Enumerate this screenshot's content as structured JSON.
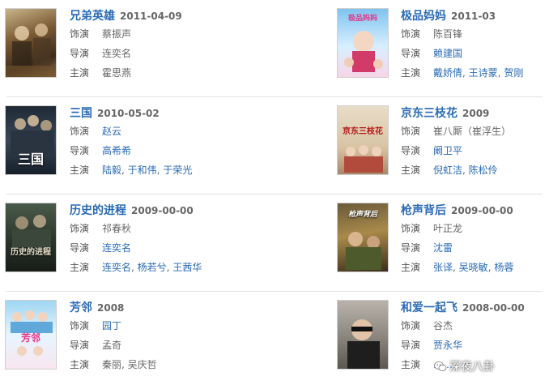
{
  "labels": {
    "role": "饰演",
    "director": "导演",
    "cast": "主演"
  },
  "cards": [
    {
      "title": "兄弟英雄",
      "date": "2011-04-09",
      "role": "蔡振声",
      "director": "连奕名",
      "cast": [
        "霍思燕"
      ],
      "poster_text": ""
    },
    {
      "title": "极品妈妈",
      "date": "2011-03",
      "role": "陈百锋",
      "director": "赖建国",
      "cast": [
        "戴娇倩",
        "王诗蒙",
        "贺刚"
      ],
      "poster_text": "极品妈妈"
    },
    {
      "title": "三国",
      "date": "2010-05-02",
      "role": "赵云",
      "director": "高希希",
      "cast": [
        "陆毅",
        "于和伟",
        "于荣光"
      ],
      "poster_text": "三国"
    },
    {
      "title": "京东三枝花",
      "date": "2009",
      "role": "崔八厮（崔浮生）",
      "director": "阚卫平",
      "cast": [
        "倪虹洁",
        "陈松伶"
      ],
      "poster_text": "京东三枝花"
    },
    {
      "title": "历史的进程",
      "date": "2009-00-00",
      "role": "祁春秋",
      "director": "连奕名",
      "cast": [
        "连奕名",
        "杨若兮",
        "王茜华"
      ],
      "poster_text": "历史的进程"
    },
    {
      "title": "枪声背后",
      "date": "2009-00-00",
      "role": "叶正龙",
      "director": "沈雷",
      "cast": [
        "张译",
        "吴晓敏",
        "杨蓉"
      ],
      "poster_text": "枪声背后"
    },
    {
      "title": "芳邻",
      "date": "2008",
      "role": "园丁",
      "director": "孟奇",
      "cast": [
        "秦丽",
        "吴庆哲"
      ],
      "poster_text": "芳邻"
    },
    {
      "title": "和爱一起飞",
      "date": "2008-00-00",
      "role": "谷杰",
      "director": "贾永华",
      "cast": [
        "……"
      ],
      "poster_text": ""
    }
  ],
  "watermark": "深夜八卦",
  "colors": {
    "link": "#2a6bb5",
    "label": "#555555",
    "date": "#666666",
    "separator": "#e1e1e1"
  },
  "icons": {
    "watermark": "wechat-bubble-icon"
  }
}
